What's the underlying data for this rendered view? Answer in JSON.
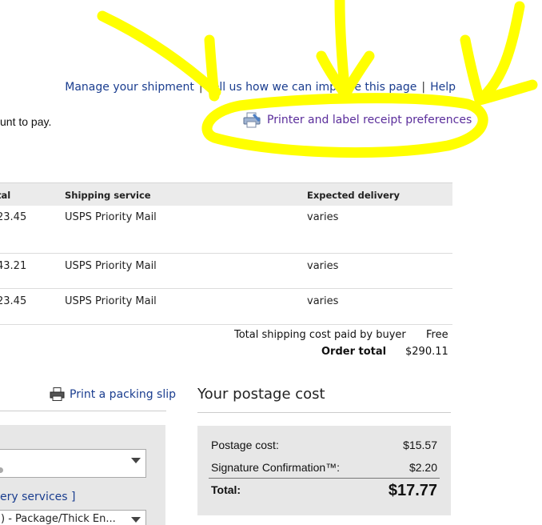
{
  "header": {
    "links": [
      {
        "label": "Manage your shipment"
      },
      {
        "label": "Tell us how we can improve this page"
      },
      {
        "label": "Help"
      }
    ],
    "separator": "|",
    "amount_text": "unt to pay.",
    "prefs_label": "Printer and label receipt preferences"
  },
  "table": {
    "columns": [
      "tal",
      "Shipping service",
      "Expected delivery"
    ],
    "rows": [
      {
        "total": "23.45",
        "service": "USPS Priority Mail",
        "delivery": "varies"
      },
      {
        "total": "43.21",
        "service": "USPS Priority Mail",
        "delivery": "varies"
      },
      {
        "total": "23.45",
        "service": "USPS Priority Mail",
        "delivery": "varies"
      }
    ],
    "shipping_cost_label": "Total shipping cost paid by buyer",
    "shipping_cost_value": "Free",
    "order_total_label": "Order total",
    "order_total_value": "$290.11"
  },
  "packing": {
    "label": "Print a packing slip"
  },
  "left_panel": {
    "more_services": "ery services ]",
    "select2_value": ") - Package/Thick En..."
  },
  "postage": {
    "title": "Your postage cost",
    "rows": [
      {
        "label": "Postage cost:",
        "value": "$15.57"
      },
      {
        "label": "Signature Confirmation™:",
        "value": "$2.20"
      }
    ],
    "total_label": "Total:",
    "total_value": "$17.77"
  },
  "colors": {
    "link": "#1a3d8f",
    "visited_link": "#5a2d9b",
    "highlight_scribble": "#ffff00",
    "panel_bg": "#e7e7e7"
  }
}
